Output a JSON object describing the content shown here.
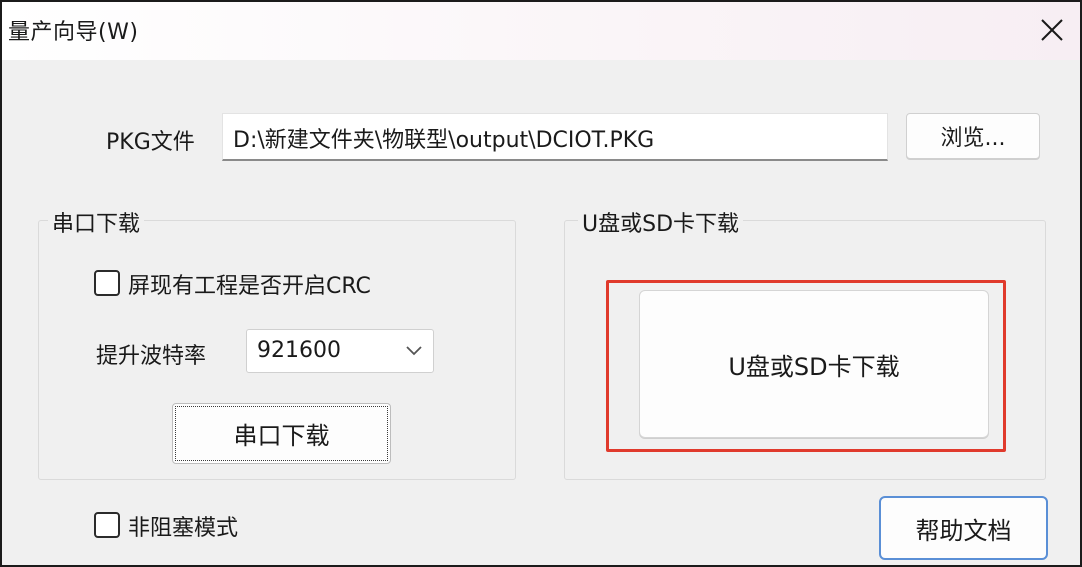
{
  "window": {
    "title": "量产向导(W)",
    "close_icon": "close-icon"
  },
  "pkg": {
    "label": "PKG文件",
    "path": "D:\\新建文件夹\\物联型\\output\\DCIOT.PKG",
    "browse_label": "浏览..."
  },
  "serial": {
    "group_title": "串口下载",
    "crc_label": "屏现有工程是否开启CRC",
    "crc_checked": false,
    "baud_label": "提升波特率",
    "baud_value": "921600",
    "download_label": "串口下载"
  },
  "usb": {
    "group_title": "U盘或SD卡下载",
    "download_label": "U盘或SD卡下载",
    "highlight_color": "#e03a2c"
  },
  "footer": {
    "nonblocking_label": "非阻塞模式",
    "nonblocking_checked": false,
    "help_label": "帮助文档"
  }
}
